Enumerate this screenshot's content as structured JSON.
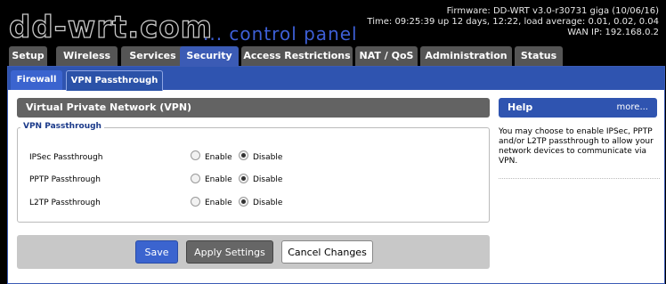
{
  "header": {
    "logo": "dd-wrt.com",
    "tagline": "... control panel",
    "firmware": "Firmware: DD-WRT v3.0-r30731 giga (10/06/16)",
    "time": "Time: 09:25:39 up 12 days, 12:22, load average: 0.01, 0.02, 0.04",
    "wan_ip": "WAN IP: 192.168.0.2"
  },
  "tabs": [
    "Setup",
    "Wireless",
    "Services",
    "Security",
    "Access Restrictions",
    "NAT / QoS",
    "Administration",
    "Status"
  ],
  "active_tab": "Security",
  "subtabs": [
    "Firewall",
    "VPN Passthrough"
  ],
  "active_subtab": "VPN Passthrough",
  "section_title": "Virtual Private Network (VPN)",
  "fieldset": {
    "legend": "VPN Passthrough",
    "rows": [
      {
        "label": "IPSec Passthrough",
        "enable": "Enable",
        "disable": "Disable",
        "selected": "Disable"
      },
      {
        "label": "PPTP Passthrough",
        "enable": "Enable",
        "disable": "Disable",
        "selected": "Disable"
      },
      {
        "label": "L2TP Passthrough",
        "enable": "Enable",
        "disable": "Disable",
        "selected": "Disable"
      }
    ]
  },
  "buttons": {
    "save": "Save",
    "apply": "Apply Settings",
    "cancel": "Cancel Changes"
  },
  "help": {
    "title": "Help",
    "more": "more...",
    "text": "You may choose to enable IPSec, PPTP and/or L2TP passthrough to allow your network devices to communicate via VPN."
  },
  "colors": {
    "accent": "#3b5bb5",
    "tab_inactive": "#555555",
    "section_header": "#636363",
    "tagline": "#3d5fd6"
  }
}
